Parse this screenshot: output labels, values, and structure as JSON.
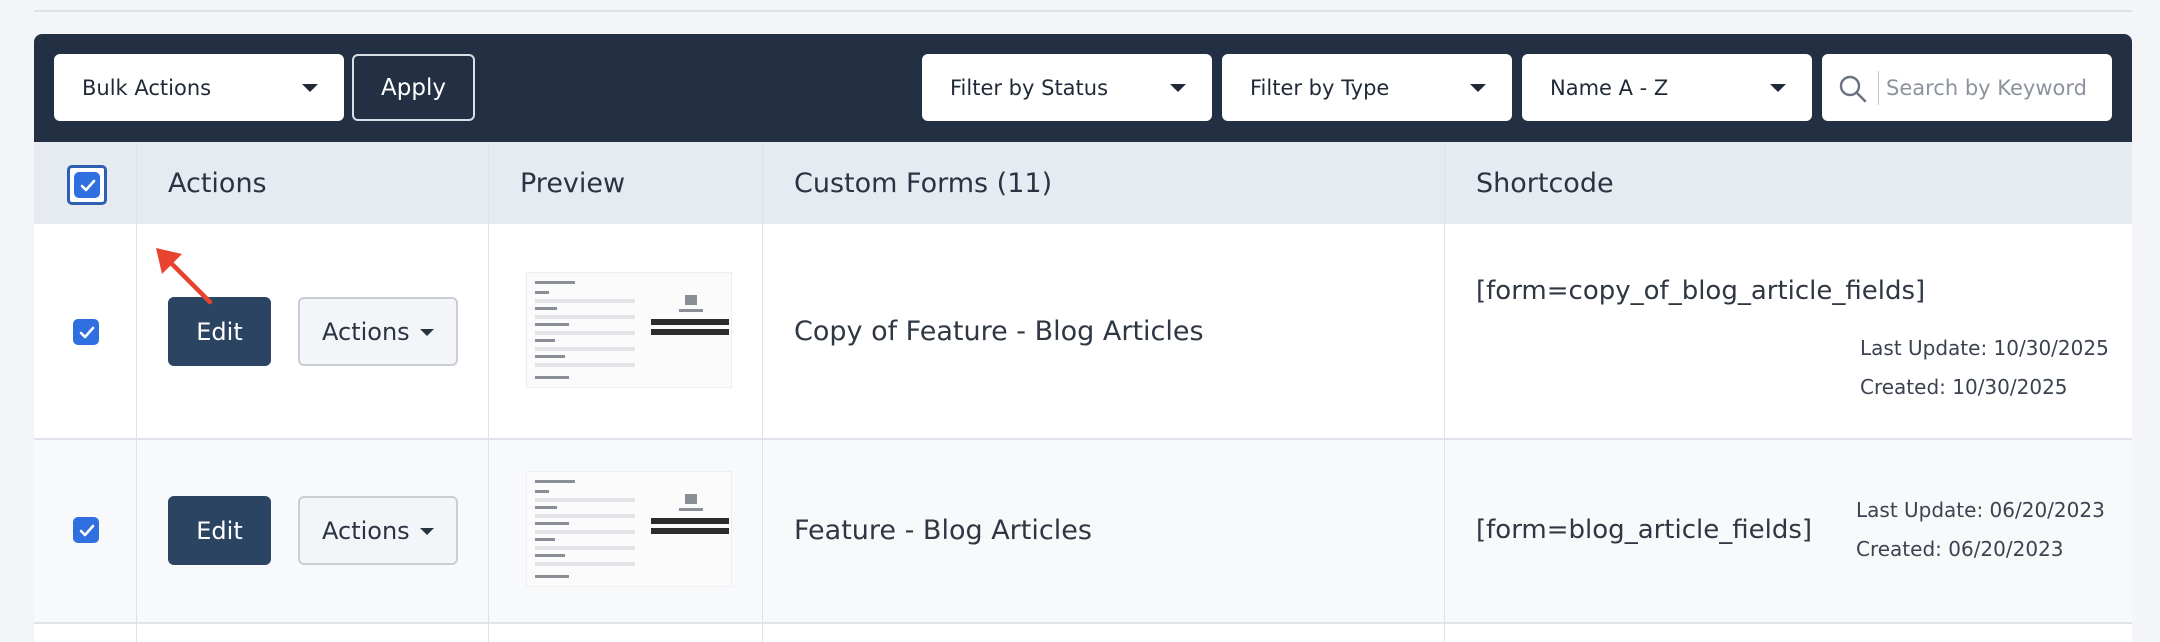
{
  "toolbar": {
    "bulk_actions": "Bulk Actions",
    "apply": "Apply",
    "filter_status": "Filter by Status",
    "filter_type": "Filter by Type",
    "sort": "Name A - Z",
    "search_placeholder": "Search by Keyword"
  },
  "table": {
    "headers": {
      "actions": "Actions",
      "preview": "Preview",
      "custom_forms": "Custom Forms (11)",
      "shortcode": "Shortcode"
    },
    "select_all_checked": true,
    "rows": [
      {
        "checked": true,
        "edit": "Edit",
        "actions": "Actions",
        "name": "Copy of Feature - Blog Articles",
        "shortcode": "[form=copy_of_blog_article_fields]",
        "last_update": "Last Update: 10/30/2025",
        "created": "Created: 10/30/2025"
      },
      {
        "checked": true,
        "edit": "Edit",
        "actions": "Actions",
        "name": "Feature - Blog Articles",
        "shortcode": "[form=blog_article_fields]",
        "last_update": "Last Update: 06/20/2023",
        "created": "Created: 06/20/2023"
      }
    ]
  },
  "colors": {
    "toolbar_bg": "#233044",
    "header_bg": "#e6ebf2",
    "edit_button": "#2b4462",
    "checkbox": "#2f6fe0",
    "annotation_arrow": "#e8432e"
  },
  "icons": {
    "search": "search-icon",
    "dropdown": "chevron-down-icon",
    "checkbox": "check-icon",
    "annotation": "arrow-icon"
  }
}
